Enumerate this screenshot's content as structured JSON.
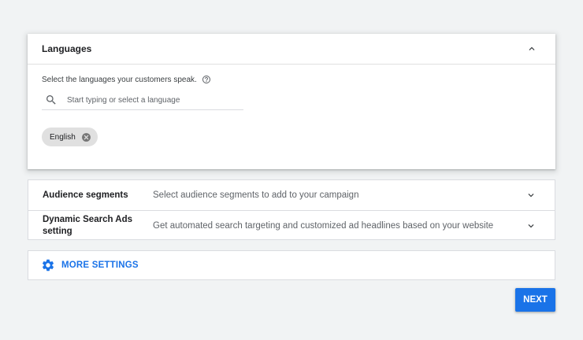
{
  "languages": {
    "title": "Languages",
    "prompt": "Select the languages your customers speak.",
    "search": {
      "placeholder": "Start typing or select a language",
      "value": ""
    },
    "selected": [
      {
        "label": "English"
      }
    ]
  },
  "settings": [
    {
      "label": "Audience segments",
      "description": "Select audience segments to add to your campaign"
    },
    {
      "label": "Dynamic Search Ads setting",
      "description": "Get automated search targeting and customized ad headlines based on your website"
    }
  ],
  "more_settings": {
    "label": "MORE SETTINGS"
  },
  "next": {
    "label": "NEXT"
  },
  "colors": {
    "accent": "#1a73e8",
    "background": "#f1f3f4",
    "chip": "#e0e0e0"
  },
  "icons": [
    "chevron-up-icon",
    "help-icon",
    "search-icon",
    "remove-chip-icon",
    "chevron-down-icon",
    "gear-icon"
  ]
}
